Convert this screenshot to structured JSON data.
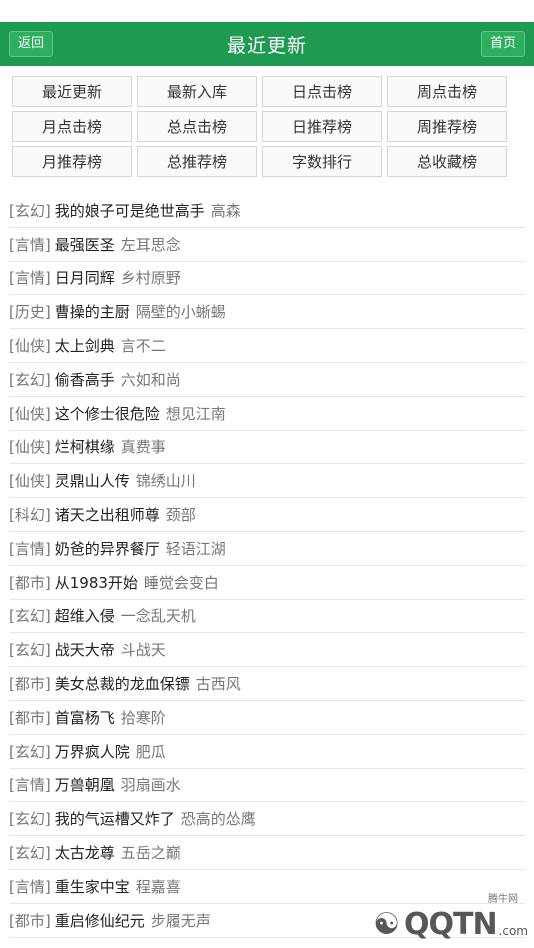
{
  "header": {
    "title": "最近更新",
    "back_label": "返回",
    "home_label": "首页"
  },
  "nav": [
    "最近更新",
    "最新入库",
    "日点击榜",
    "周点击榜",
    "月点击榜",
    "总点击榜",
    "日推荐榜",
    "周推荐榜",
    "月推荐榜",
    "总推荐榜",
    "字数排行",
    "总收藏榜"
  ],
  "books": [
    {
      "cat": "玄幻",
      "name": "我的娘子可是绝世高手",
      "author": "高森"
    },
    {
      "cat": "言情",
      "name": "最强医圣",
      "author": "左耳思念"
    },
    {
      "cat": "言情",
      "name": "日月同辉",
      "author": "乡村原野"
    },
    {
      "cat": "历史",
      "name": "曹操的主厨",
      "author": "隔壁的小蜥蜴"
    },
    {
      "cat": "仙侠",
      "name": "太上剑典",
      "author": "言不二"
    },
    {
      "cat": "玄幻",
      "name": "偷香高手",
      "author": "六如和尚"
    },
    {
      "cat": "仙侠",
      "name": "这个修士很危险",
      "author": "想见江南"
    },
    {
      "cat": "仙侠",
      "name": "烂柯棋缘",
      "author": "真费事"
    },
    {
      "cat": "仙侠",
      "name": "灵鼎山人传",
      "author": "锦绣山川"
    },
    {
      "cat": "科幻",
      "name": "诸天之出租师尊",
      "author": "颈部"
    },
    {
      "cat": "言情",
      "name": "奶爸的异界餐厅",
      "author": "轻语江湖"
    },
    {
      "cat": "都市",
      "name": "从1983开始",
      "author": "睡觉会变白"
    },
    {
      "cat": "玄幻",
      "name": "超维入侵",
      "author": "一念乱天机"
    },
    {
      "cat": "玄幻",
      "name": "战天大帝",
      "author": "斗战天"
    },
    {
      "cat": "都市",
      "name": "美女总裁的龙血保镖",
      "author": "古西风"
    },
    {
      "cat": "都市",
      "name": "首富杨飞",
      "author": "拾寒阶"
    },
    {
      "cat": "玄幻",
      "name": "万界疯人院",
      "author": "肥瓜"
    },
    {
      "cat": "言情",
      "name": "万兽朝凰",
      "author": "羽扇画水"
    },
    {
      "cat": "玄幻",
      "name": "我的气运槽又炸了",
      "author": "恐高的怂鹰"
    },
    {
      "cat": "玄幻",
      "name": "太古龙尊",
      "author": "五岳之巅"
    },
    {
      "cat": "言情",
      "name": "重生家中宝",
      "author": "程嘉喜"
    },
    {
      "cat": "都市",
      "name": "重启修仙纪元",
      "author": "步履无声"
    }
  ],
  "watermark": {
    "site": "腾牛网",
    "brand": "QQTN",
    "suffix": ".com"
  }
}
